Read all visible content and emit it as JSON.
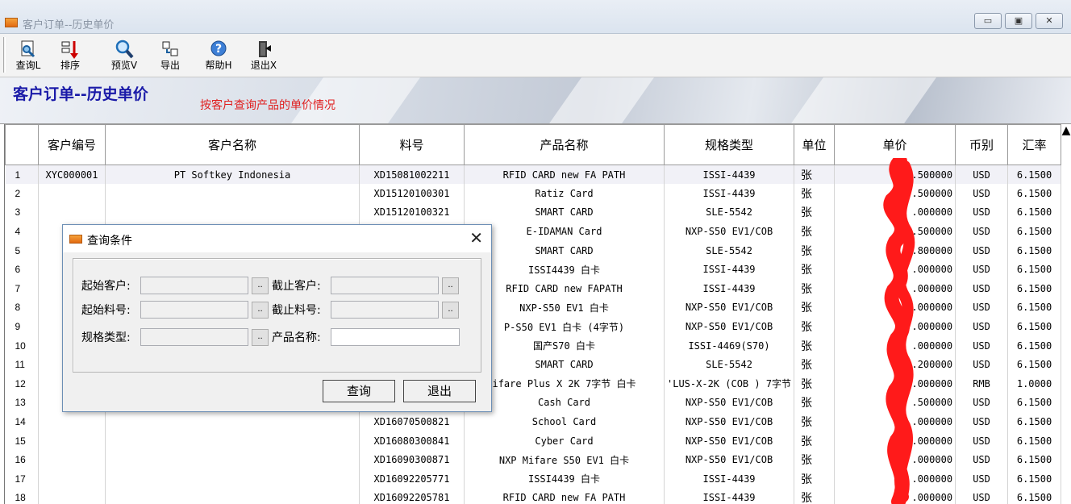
{
  "window": {
    "title": "客户订单--历史单价",
    "min_label": "▭",
    "max_label": "▣",
    "close_label": "✕"
  },
  "toolbar": {
    "query": "查询L",
    "sort": "排序",
    "preview": "预览V",
    "export": "导出",
    "help": "帮助H",
    "exit": "退出X"
  },
  "banner": {
    "heading": "客户订单--历史单价",
    "subtitle": "按客户查询产品的单价情况"
  },
  "grid": {
    "columns": [
      "",
      "客户编号",
      "客户名称",
      "料号",
      "产品名称",
      "规格类型",
      "单位",
      "单价",
      "币别",
      "汇率"
    ],
    "rows": [
      {
        "n": "1",
        "code": "XYC000001",
        "name": "PT Softkey Indonesia",
        "part": "XD15081002211",
        "product": "RFID CARD new FA PATH",
        "spec": "ISSI-4439",
        "unit": "张",
        "price": ".500000",
        "cur": "USD",
        "rate": "6.1500"
      },
      {
        "n": "2",
        "code": "",
        "name": "",
        "part": "XD15120100301",
        "product": "Ratiz Card",
        "spec": "ISSI-4439",
        "unit": "张",
        "price": ".500000",
        "cur": "USD",
        "rate": "6.1500"
      },
      {
        "n": "3",
        "code": "",
        "name": "",
        "part": "XD15120100321",
        "product": "SMART CARD",
        "spec": "SLE-5542",
        "unit": "张",
        "price": ".000000",
        "cur": "USD",
        "rate": "6.1500"
      },
      {
        "n": "4",
        "code": "",
        "name": "",
        "part": "",
        "product": "E-IDAMAN Card",
        "spec": "NXP-S50 EV1/COB",
        "unit": "张",
        "price": ".500000",
        "cur": "USD",
        "rate": "6.1500"
      },
      {
        "n": "5",
        "code": "",
        "name": "",
        "part": "",
        "product": "SMART CARD",
        "spec": "SLE-5542",
        "unit": "张",
        "price": ".800000",
        "cur": "USD",
        "rate": "6.1500"
      },
      {
        "n": "6",
        "code": "",
        "name": "",
        "part": "",
        "product": "ISSI4439 白卡",
        "spec": "ISSI-4439",
        "unit": "张",
        "price": ".000000",
        "cur": "USD",
        "rate": "6.1500"
      },
      {
        "n": "7",
        "code": "",
        "name": "",
        "part": "",
        "product": "RFID CARD new FAPATH",
        "spec": "ISSI-4439",
        "unit": "张",
        "price": ".000000",
        "cur": "USD",
        "rate": "6.1500"
      },
      {
        "n": "8",
        "code": "",
        "name": "",
        "part": "",
        "product": "NXP-S50 EV1 白卡",
        "spec": "NXP-S50 EV1/COB",
        "unit": "张",
        "price": ".000000",
        "cur": "USD",
        "rate": "6.1500"
      },
      {
        "n": "9",
        "code": "",
        "name": "",
        "part": "",
        "product": "P-S50 EV1 白卡 (4字节)",
        "spec": "NXP-S50 EV1/COB",
        "unit": "张",
        "price": ".000000",
        "cur": "USD",
        "rate": "6.1500"
      },
      {
        "n": "10",
        "code": "",
        "name": "",
        "part": "",
        "product": "国产S70 白卡",
        "spec": "ISSI-4469(S70)",
        "unit": "张",
        "price": ".000000",
        "cur": "USD",
        "rate": "6.1500"
      },
      {
        "n": "11",
        "code": "",
        "name": "",
        "part": "",
        "product": "SMART CARD",
        "spec": "SLE-5542",
        "unit": "张",
        "price": ".200000",
        "cur": "USD",
        "rate": "6.1500"
      },
      {
        "n": "12",
        "code": "",
        "name": "",
        "part": "",
        "product": "ifare Plus X 2K 7字节 白卡",
        "spec": "'LUS-X-2K (COB ) 7字节",
        "unit": "张",
        "price": ".000000",
        "cur": "RMB",
        "rate": "1.0000"
      },
      {
        "n": "13",
        "code": "",
        "name": "",
        "part": "",
        "product": "Cash Card",
        "spec": "NXP-S50 EV1/COB",
        "unit": "张",
        "price": ".500000",
        "cur": "USD",
        "rate": "6.1500"
      },
      {
        "n": "14",
        "code": "",
        "name": "",
        "part": "XD16070500821",
        "product": "School Card",
        "spec": "NXP-S50 EV1/COB",
        "unit": "张",
        "price": ".000000",
        "cur": "USD",
        "rate": "6.1500"
      },
      {
        "n": "15",
        "code": "",
        "name": "",
        "part": "XD16080300841",
        "product": "Cyber Card",
        "spec": "NXP-S50 EV1/COB",
        "unit": "张",
        "price": ".000000",
        "cur": "USD",
        "rate": "6.1500"
      },
      {
        "n": "16",
        "code": "",
        "name": "",
        "part": "XD16090300871",
        "product": "NXP Mifare S50 EV1 白卡",
        "spec": "NXP-S50 EV1/COB",
        "unit": "张",
        "price": ".000000",
        "cur": "USD",
        "rate": "6.1500"
      },
      {
        "n": "17",
        "code": "",
        "name": "",
        "part": "XD16092205771",
        "product": "ISSI4439 白卡",
        "spec": "ISSI-4439",
        "unit": "张",
        "price": ".000000",
        "cur": "USD",
        "rate": "6.1500"
      },
      {
        "n": "18",
        "code": "",
        "name": "",
        "part": "XD16092205781",
        "product": "RFID CARD new FA PATH",
        "spec": "ISSI-4439",
        "unit": "张",
        "price": ".000000",
        "cur": "USD",
        "rate": "6.1500"
      }
    ]
  },
  "dialog": {
    "title": "查询条件",
    "close_label": "✕",
    "start_customer_label": "起始客户:",
    "end_customer_label": "截止客户:",
    "start_part_label": "起始料号:",
    "end_part_label": "截止料号:",
    "spec_label": "规格类型:",
    "product_name_label": "产品名称:",
    "browse_label": "..",
    "query_button": "查询",
    "exit_button": "退出"
  },
  "colors": {
    "heading": "#1a1aa8",
    "subtitle": "#e02020",
    "scribble": "#ff1a1a"
  }
}
